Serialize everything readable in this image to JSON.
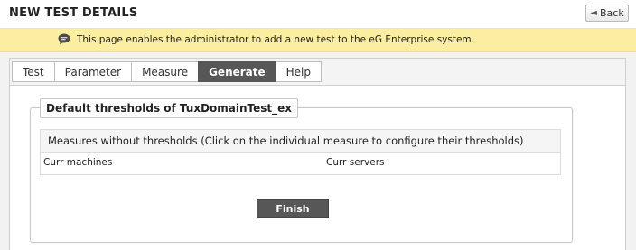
{
  "header": {
    "title": "NEW TEST DETAILS",
    "back_label": "Back",
    "back_icon": "back-arrow-icon"
  },
  "info_bar": {
    "icon": "speech-bubble-icon",
    "message": "This page enables the administrator to add a new test to the eG Enterprise system.",
    "background": "#fbeea0"
  },
  "tabs": [
    {
      "label": "Test",
      "active": false
    },
    {
      "label": "Parameter",
      "active": false
    },
    {
      "label": "Measure",
      "active": false
    },
    {
      "label": "Generate",
      "active": true
    },
    {
      "label": "Help",
      "active": false
    }
  ],
  "thresholds": {
    "legend": "Default thresholds of TuxDomainTest_ex",
    "measures_header": "Measures without thresholds (Click on the individual measure to configure their thresholds)",
    "measures": [
      "Curr machines",
      "Curr servers"
    ]
  },
  "finish_label": "Finish",
  "colors": {
    "active_tab": "#575757",
    "finish_button": "#575757"
  }
}
